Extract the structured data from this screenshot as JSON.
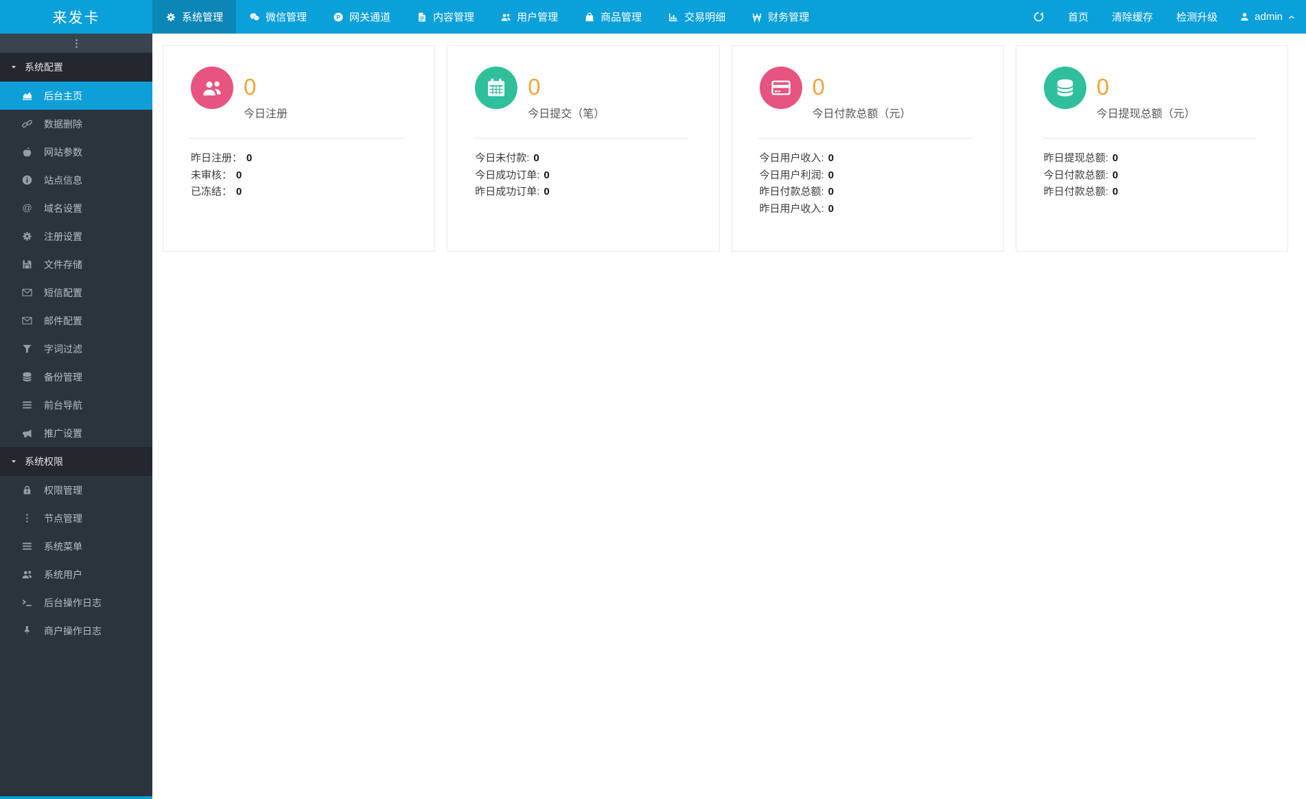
{
  "brand": "来发卡",
  "navbar": {
    "menu": [
      {
        "label": "系统管理",
        "icon": "gear-icon",
        "active": true
      },
      {
        "label": "微信管理",
        "icon": "wechat-icon",
        "active": false
      },
      {
        "label": "网关通道",
        "icon": "circle-p-icon",
        "active": false
      },
      {
        "label": "内容管理",
        "icon": "file-icon",
        "active": false
      },
      {
        "label": "用户管理",
        "icon": "users-icon",
        "active": false
      },
      {
        "label": "商品管理",
        "icon": "shopping-bag-icon",
        "active": false
      },
      {
        "label": "交易明细",
        "icon": "chart-bar-icon",
        "active": false
      },
      {
        "label": "财务管理",
        "icon": "won-icon",
        "active": false
      }
    ],
    "right": {
      "refresh_icon": "refresh-icon",
      "home": "首页",
      "clear_cache": "清除缓存",
      "check_upgrade": "检测升级",
      "user_icon": "user-icon",
      "username": "admin",
      "chevron_icon": "chevron-up-icon"
    }
  },
  "sidebar": {
    "toggle_icon": "ellipsis-v-icon",
    "sections": [
      {
        "title": "系统配置",
        "caret_icon": "caret-down-icon",
        "items": [
          {
            "label": "后台主页",
            "icon": "area-chart-icon",
            "active": true
          },
          {
            "label": "数据删除",
            "icon": "link-icon",
            "active": false
          },
          {
            "label": "网站参数",
            "icon": "apple-icon",
            "active": false
          },
          {
            "label": "站点信息",
            "icon": "info-circle-icon",
            "active": false
          },
          {
            "label": "域名设置",
            "icon": "at-icon",
            "active": false
          },
          {
            "label": "注册设置",
            "icon": "gear-icon",
            "active": false
          },
          {
            "label": "文件存储",
            "icon": "save-icon",
            "active": false
          },
          {
            "label": "短信配置",
            "icon": "envelope-icon",
            "active": false
          },
          {
            "label": "邮件配置",
            "icon": "envelope-icon",
            "active": false
          },
          {
            "label": "字词过滤",
            "icon": "filter-icon",
            "active": false
          },
          {
            "label": "备份管理",
            "icon": "database-icon",
            "active": false
          },
          {
            "label": "前台导航",
            "icon": "bars-icon",
            "active": false
          },
          {
            "label": "推广设置",
            "icon": "bullhorn-icon",
            "active": false
          }
        ]
      },
      {
        "title": "系统权限",
        "caret_icon": "caret-down-icon",
        "items": [
          {
            "label": "权限管理",
            "icon": "lock-icon",
            "active": false
          },
          {
            "label": "节点管理",
            "icon": "ellipsis-v-icon",
            "active": false
          },
          {
            "label": "系统菜单",
            "icon": "bars-icon",
            "active": false
          },
          {
            "label": "系统用户",
            "icon": "users-icon",
            "active": false
          },
          {
            "label": "后台操作日志",
            "icon": "terminal-icon",
            "active": false
          },
          {
            "label": "商户操作日志",
            "icon": "thumbtack-icon",
            "active": false
          }
        ]
      }
    ]
  },
  "cards": [
    {
      "icon": "users-icon",
      "color": "#e7547f",
      "value": "0",
      "label": "今日注册",
      "rows": [
        {
          "label": "昨日注册：",
          "value": "0"
        },
        {
          "label": "未审核：",
          "value": "0"
        },
        {
          "label": "已冻结：",
          "value": "0"
        }
      ]
    },
    {
      "icon": "calendar-icon",
      "color": "#30bf9d",
      "value": "0",
      "label": "今日提交（笔）",
      "rows": [
        {
          "label": "今日未付款:",
          "value": "0"
        },
        {
          "label": "今日成功订单:",
          "value": "0"
        },
        {
          "label": "昨日成功订单:",
          "value": "0"
        }
      ]
    },
    {
      "icon": "credit-card-icon",
      "color": "#e7547f",
      "value": "0",
      "label": "今日付款总额（元）",
      "rows": [
        {
          "label": "今日用户收入:",
          "value": "0"
        },
        {
          "label": "今日用户利润:",
          "value": "0"
        },
        {
          "label": "昨日付款总额:",
          "value": "0"
        },
        {
          "label": "昨日用户收入:",
          "value": "0"
        }
      ]
    },
    {
      "icon": "database-icon",
      "color": "#30bf9d",
      "value": "0",
      "label": "今日提现总额（元）",
      "rows": [
        {
          "label": "昨日提现总额:",
          "value": "0"
        },
        {
          "label": "今日付款总额:",
          "value": "0"
        },
        {
          "label": "昨日付款总额:",
          "value": "0"
        }
      ]
    }
  ],
  "colors": {
    "navbar": "#0aa0d9",
    "navbar_active": "#0b86b6",
    "sidebar": "#2b333c",
    "sidebar_header": "#23272e",
    "sidebar_toggle": "#3a4350",
    "active_item": "#0f9fd8",
    "pink": "#e7547f",
    "teal": "#30bf9d",
    "value_orange": "#f3a43a",
    "card_border": "#e7eaec"
  }
}
